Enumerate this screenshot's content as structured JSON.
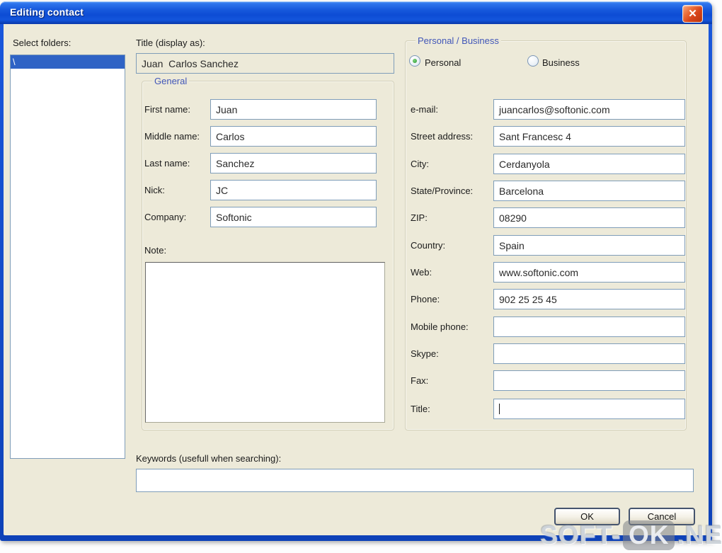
{
  "window": {
    "title": "Editing contact",
    "close_icon": "✕"
  },
  "left": {
    "select_folders_label": "Select folders:",
    "folder_items": [
      {
        "label": "\\",
        "selected": true
      }
    ]
  },
  "middle": {
    "title_display_label": "Title (display as):",
    "title_display_value": "Juan  Carlos Sanchez",
    "general_group_label": "General",
    "fields": [
      {
        "label": "First name:",
        "value": "Juan"
      },
      {
        "label": "Middle name:",
        "value": "Carlos"
      },
      {
        "label": "Last name:",
        "value": "Sanchez"
      },
      {
        "label": "Nick:",
        "value": "JC"
      },
      {
        "label": "Company:",
        "value": "Softonic"
      }
    ],
    "note_label": "Note:",
    "note_value": ""
  },
  "right": {
    "group_label": "Personal / Business",
    "radio_personal": {
      "label": "Personal",
      "selected": true
    },
    "radio_business": {
      "label": "Business",
      "selected": false
    },
    "fields": [
      {
        "label": "e-mail:",
        "value": "juancarlos@softonic.com"
      },
      {
        "label": "Street address:",
        "value": "Sant Francesc 4"
      },
      {
        "label": "City:",
        "value": "Cerdanyola"
      },
      {
        "label": "State/Province:",
        "value": "Barcelona"
      },
      {
        "label": "ZIP:",
        "value": "08290"
      },
      {
        "label": "Country:",
        "value": "Spain"
      },
      {
        "label": "Web:",
        "value": "www.softonic.com"
      },
      {
        "label": "Phone:",
        "value": "902 25 25 45"
      },
      {
        "label": "Mobile phone:",
        "value": ""
      },
      {
        "label": "Skype:",
        "value": ""
      },
      {
        "label": "Fax:",
        "value": ""
      },
      {
        "label": "Title:",
        "value": "",
        "focused": true
      }
    ]
  },
  "bottom": {
    "keywords_label": "Keywords (usefull when searching):",
    "keywords_value": "",
    "ok_label": "OK",
    "cancel_label": "Cancel"
  },
  "watermark": {
    "part1": "SOFT-",
    "part2": "OK",
    "part3": ".NET"
  },
  "colors": {
    "titlebar_blue": "#1453d6",
    "selection_blue": "#2f63c5",
    "caption_blue": "#4156b8",
    "input_border": "#7f9db9",
    "dialog_bg": "#edead9",
    "close_red": "#d9501e"
  }
}
